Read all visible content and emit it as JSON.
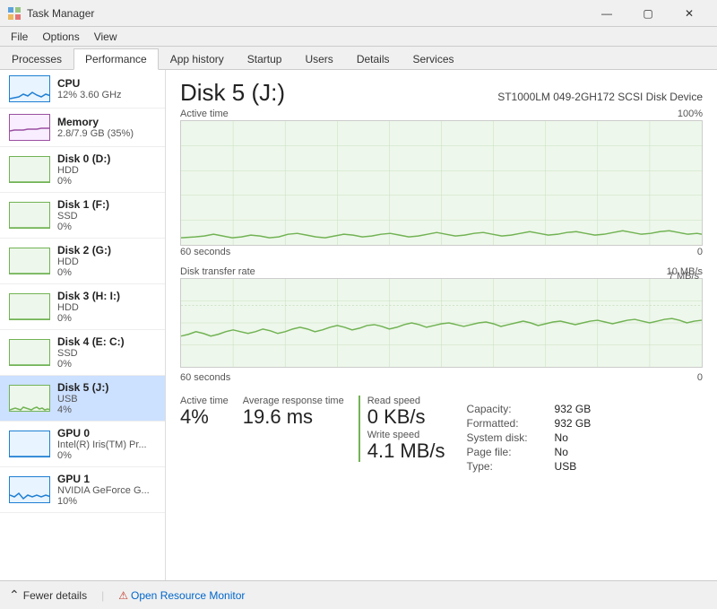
{
  "window": {
    "title": "Task Manager",
    "controls": [
      "—",
      "☐",
      "✕"
    ]
  },
  "menu": {
    "items": [
      "File",
      "Options",
      "View"
    ]
  },
  "tabs": [
    {
      "label": "Processes",
      "active": false
    },
    {
      "label": "Performance",
      "active": true
    },
    {
      "label": "App history",
      "active": false
    },
    {
      "label": "Startup",
      "active": false
    },
    {
      "label": "Users",
      "active": false
    },
    {
      "label": "Details",
      "active": false
    },
    {
      "label": "Services",
      "active": false
    }
  ],
  "sidebar": {
    "items": [
      {
        "name": "CPU",
        "sub": "12% 3.60 GHz",
        "pct": "",
        "type": "cpu"
      },
      {
        "name": "Memory",
        "sub": "2.8/7.9 GB (35%)",
        "pct": "",
        "type": "mem"
      },
      {
        "name": "Disk 0 (D:)",
        "sub": "HDD",
        "pct": "0%",
        "type": "disk"
      },
      {
        "name": "Disk 1 (F:)",
        "sub": "SSD",
        "pct": "0%",
        "type": "disk"
      },
      {
        "name": "Disk 2 (G:)",
        "sub": "HDD",
        "pct": "0%",
        "type": "disk"
      },
      {
        "name": "Disk 3 (H: I:)",
        "sub": "HDD",
        "pct": "0%",
        "type": "disk"
      },
      {
        "name": "Disk 4 (E: C:)",
        "sub": "SSD",
        "pct": "0%",
        "type": "disk"
      },
      {
        "name": "Disk 5 (J:)",
        "sub": "USB",
        "pct": "4%",
        "type": "disk",
        "active": true
      },
      {
        "name": "GPU 0",
        "sub": "Intel(R) Iris(TM) Pr...",
        "pct": "0%",
        "type": "gpu"
      },
      {
        "name": "GPU 1",
        "sub": "NVIDIA GeForce G...",
        "pct": "10%",
        "type": "gpu"
      }
    ]
  },
  "detail": {
    "title": "Disk 5 (J:)",
    "subtitle": "ST1000LM 049-2GH172 SCSI Disk Device",
    "chart1": {
      "label": "Active time",
      "max_label": "100%",
      "bottom_left": "60 seconds",
      "bottom_right": "0"
    },
    "chart2": {
      "label": "Disk transfer rate",
      "max_label": "10 MB/s",
      "sub_label": "7 MB/s",
      "bottom_left": "60 seconds",
      "bottom_right": "0"
    },
    "stats": {
      "active_time_label": "Active time",
      "active_time_value": "4%",
      "avg_response_label": "Average response time",
      "avg_response_value": "19.6 ms",
      "read_speed_label": "Read speed",
      "read_speed_value": "0 KB/s",
      "write_speed_label": "Write speed",
      "write_speed_value": "4.1 MB/s"
    },
    "info": {
      "capacity_label": "Capacity:",
      "capacity_value": "932 GB",
      "formatted_label": "Formatted:",
      "formatted_value": "932 GB",
      "system_disk_label": "System disk:",
      "system_disk_value": "No",
      "page_file_label": "Page file:",
      "page_file_value": "No",
      "type_label": "Type:",
      "type_value": "USB"
    }
  },
  "bottom": {
    "fewer_details_label": "Fewer details",
    "resource_monitor_label": "Open Resource Monitor"
  },
  "colors": {
    "accent_green": "#71b354",
    "accent_blue": "#1f7fd4",
    "accent_purple": "#9b4fa1",
    "chart_bg": "#eef7eb",
    "chart_line": "#71b354"
  }
}
